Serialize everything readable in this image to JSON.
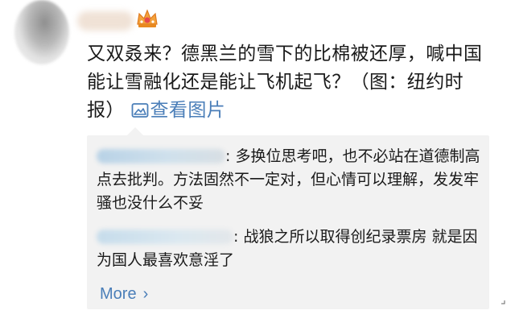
{
  "post": {
    "text": "又双叒来？德黑兰的雪下的比棉被还厚，喊中国能让雪融化还是能让飞机起飞？（图：纽约时报）",
    "view_image_label": "查看图片"
  },
  "comments": [
    {
      "text": ": 多换位思考吧，也不必站在道德制高点去批判。方法固然不一定对，但心情可以理解，发发牢骚也没什么不妥"
    },
    {
      "text": ": 战狼之所以取得创纪录票房 就是因为国人最喜欢意淫了"
    }
  ],
  "more": {
    "label": "More",
    "chevron": "›"
  },
  "icons": {
    "crown": "crown-badge-icon",
    "image": "image-icon"
  },
  "colors": {
    "link": "#4a7eb8",
    "comment_bg": "#f2f2f2",
    "text": "#1a1a1a"
  }
}
